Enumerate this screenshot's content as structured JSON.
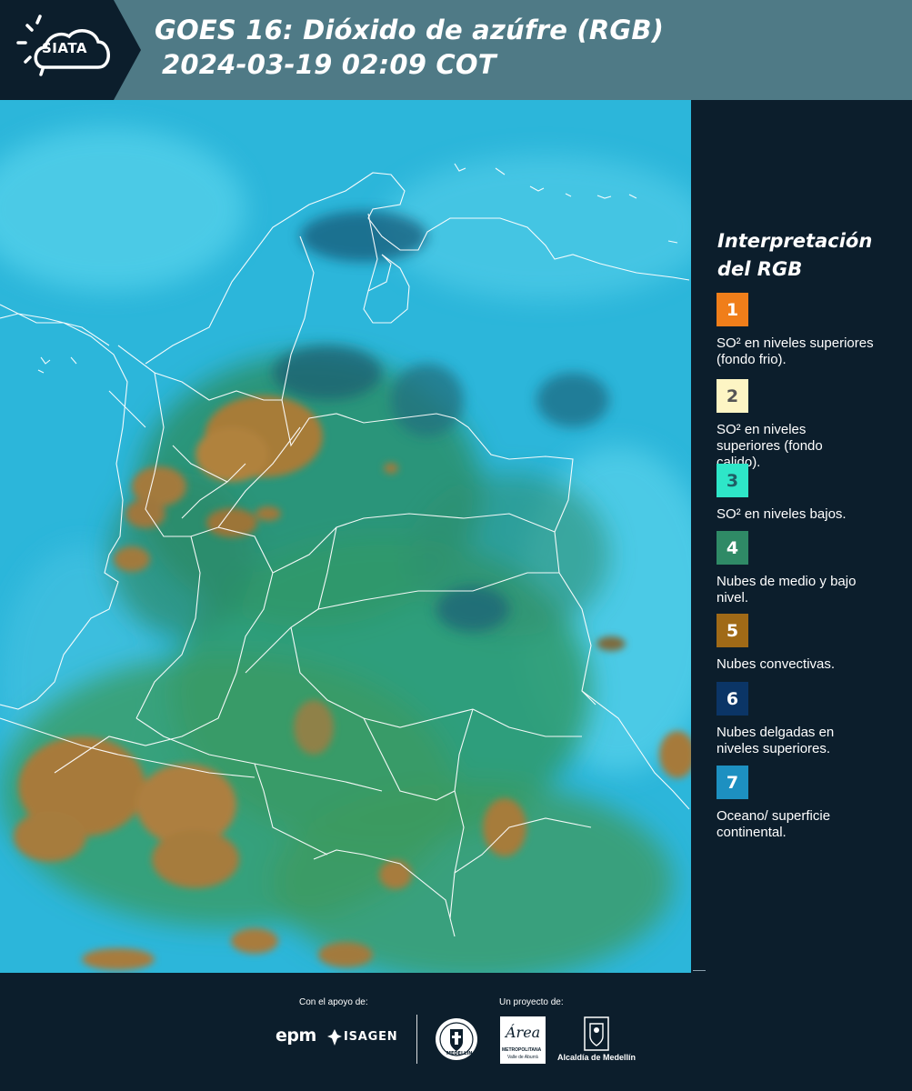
{
  "header": {
    "logo_text": "SIATA",
    "title_line1": "GOES 16: Dióxido de azúfre (RGB)",
    "title_line2": "2024-03-19 02:09 COT"
  },
  "map": {
    "description_icon": "satellite-map"
  },
  "legend": {
    "title": "Interpretación del RGB",
    "items": [
      {
        "number": "1",
        "color": "#f07e1a",
        "text_color": "#ffffff",
        "text": "SO² en niveles superiores (fondo frio)."
      },
      {
        "number": "2",
        "color": "#fdf5c4",
        "text_color": "#555555",
        "text": "SO² en niveles superiores (fondo calido)."
      },
      {
        "number": "3",
        "color": "#2ee6c8",
        "text_color": "#1f5f66",
        "text": "SO² en niveles bajos."
      },
      {
        "number": "4",
        "color": "#2f8a66",
        "text_color": "#ffffff",
        "text": "Nubes de medio y bajo nivel."
      },
      {
        "number": "5",
        "color": "#a06a17",
        "text_color": "#ffffff",
        "text": "Nubes convectivas."
      },
      {
        "number": "6",
        "color": "#0b3566",
        "text_color": "#ffffff",
        "text": "Nubes delgadas en niveles superiores."
      },
      {
        "number": "7",
        "color": "#1d90c1",
        "text_color": "#ffffff",
        "text": "Oceano/ superficie continental."
      }
    ]
  },
  "footer": {
    "support_label": "Con el apoyo de:",
    "project_label": "Un proyecto de:",
    "sponsor_epm": "epm",
    "sponsor_isagen": "ISAGEN",
    "sponsor_area_title": "Área",
    "sponsor_area_sub": "METROPOLITANA",
    "sponsor_area_sub2": "Valle de Aburrá",
    "sponsor_alcaldia": "Alcaldía de Medellín",
    "seal_text": "MEDELLÍN"
  }
}
